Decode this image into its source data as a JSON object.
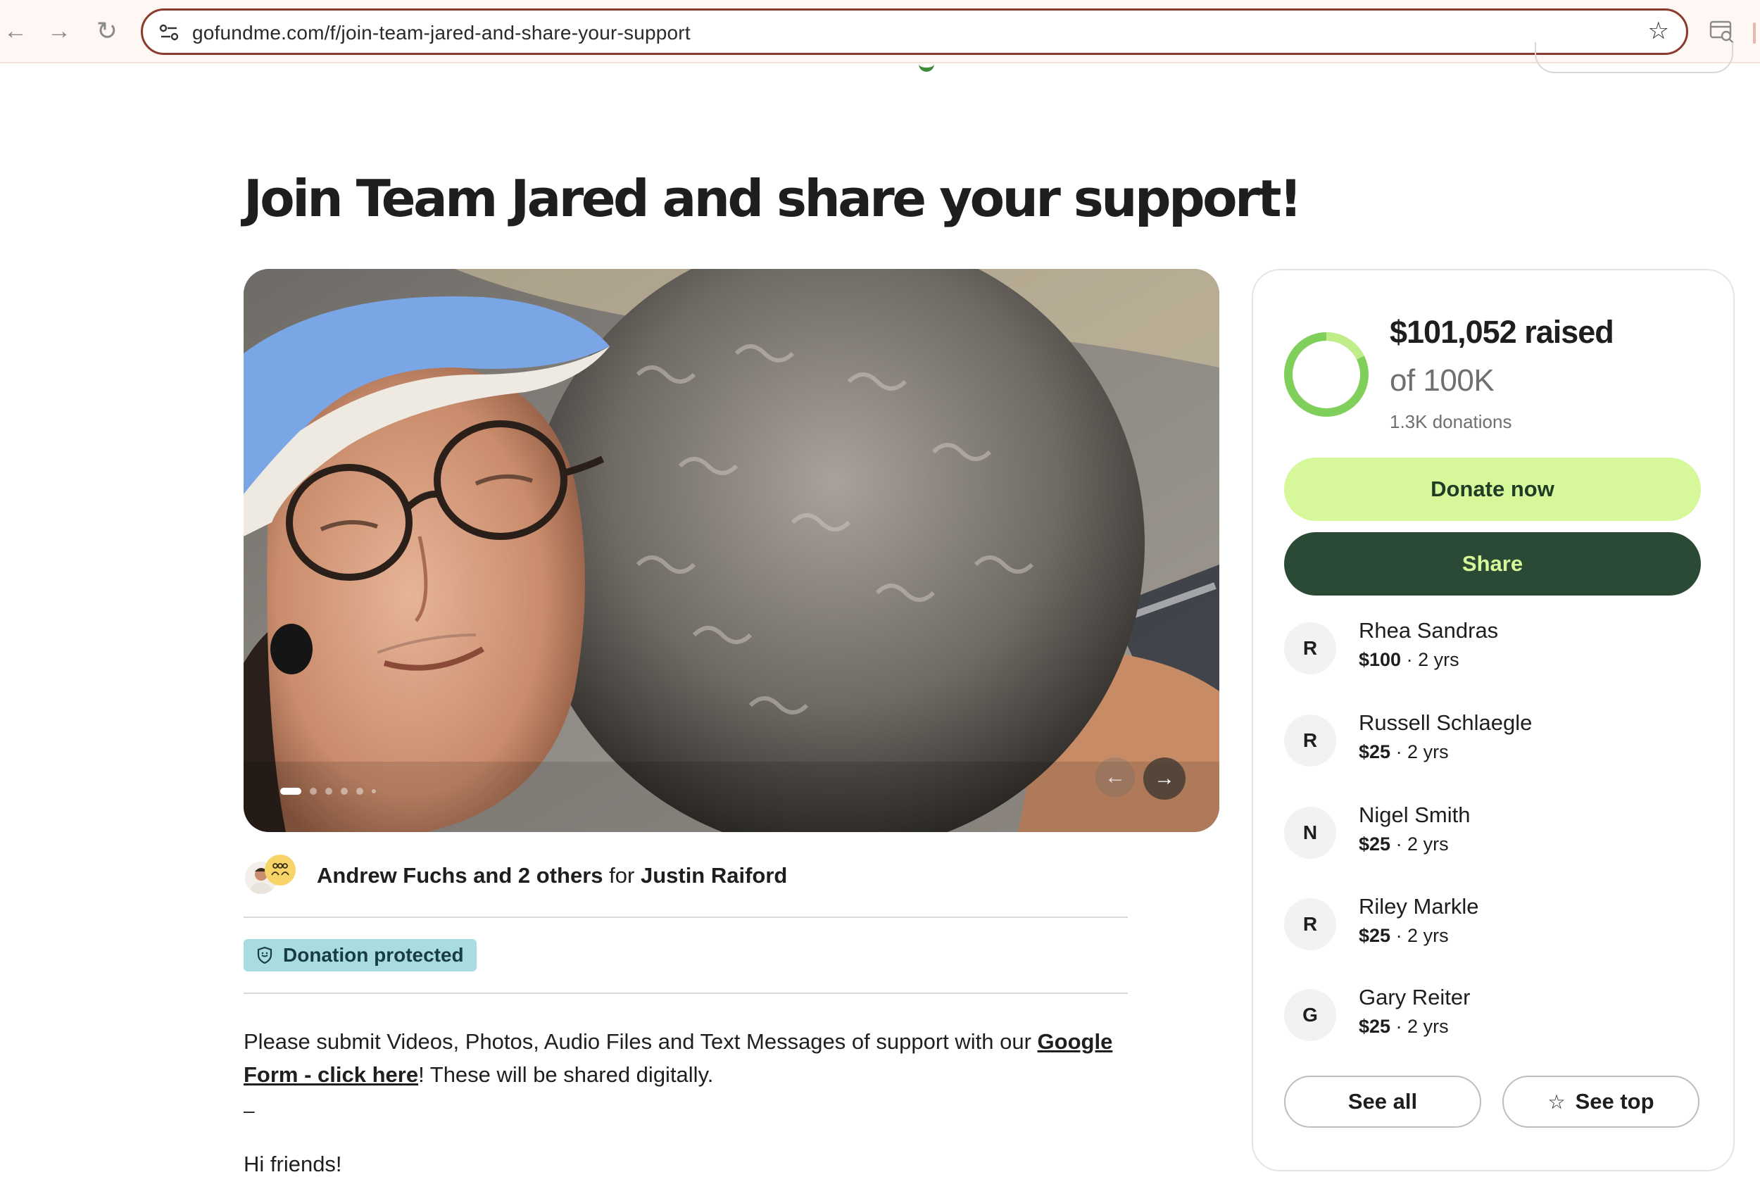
{
  "browser": {
    "url": "gofundme.com/f/join-team-jared-and-share-your-support",
    "back_glyph": "←",
    "forward_glyph": "→",
    "reload_glyph": "↻",
    "bookmark_glyph": "☆"
  },
  "campaign": {
    "title": "Join Team Jared and share your support!",
    "organizer": "Andrew Fuchs and 2 others",
    "organizer_for": "for",
    "beneficiary": "Justin Raiford",
    "badge": "Donation protected",
    "story_text_before": "Please submit Videos, Photos, Audio Files and Text Messages of support with our ",
    "story_link": "Google Form - click here",
    "story_text_after": "! These will be shared digitally.",
    "story_dash": "–",
    "story_greeting": "Hi friends!"
  },
  "carousel": {
    "prev_glyph": "←",
    "next_glyph": "→",
    "slide_count": 6,
    "active_slide": 1
  },
  "fundraiser": {
    "raised_label": "$101,052 raised",
    "goal_label": "of 100K",
    "donations_label": "1.3K donations",
    "progress_fraction": 1.0,
    "donate_label": "Donate now",
    "share_label": "Share",
    "donors": [
      {
        "initial": "R",
        "name": "Rhea Sandras",
        "amount": "$100",
        "time": " · 2 yrs"
      },
      {
        "initial": "R",
        "name": "Russell Schlaegle",
        "amount": "$25",
        "time": " · 2 yrs"
      },
      {
        "initial": "N",
        "name": "Nigel Smith",
        "amount": "$25",
        "time": " · 2 yrs"
      },
      {
        "initial": "R",
        "name": "Riley Markle",
        "amount": "$25",
        "time": " · 2 yrs"
      },
      {
        "initial": "G",
        "name": "Gary Reiter",
        "amount": "$25",
        "time": " · 2 yrs"
      }
    ],
    "see_all_label": "See all",
    "see_top_label": "See top",
    "see_top_icon": "☆"
  },
  "colors": {
    "donate_button": "#d6f79a",
    "share_button": "#2b4a36",
    "progress_ring": "#7fcf5a",
    "badge_bg": "#a8dce0",
    "omnibox_border": "#8b3a2d"
  }
}
